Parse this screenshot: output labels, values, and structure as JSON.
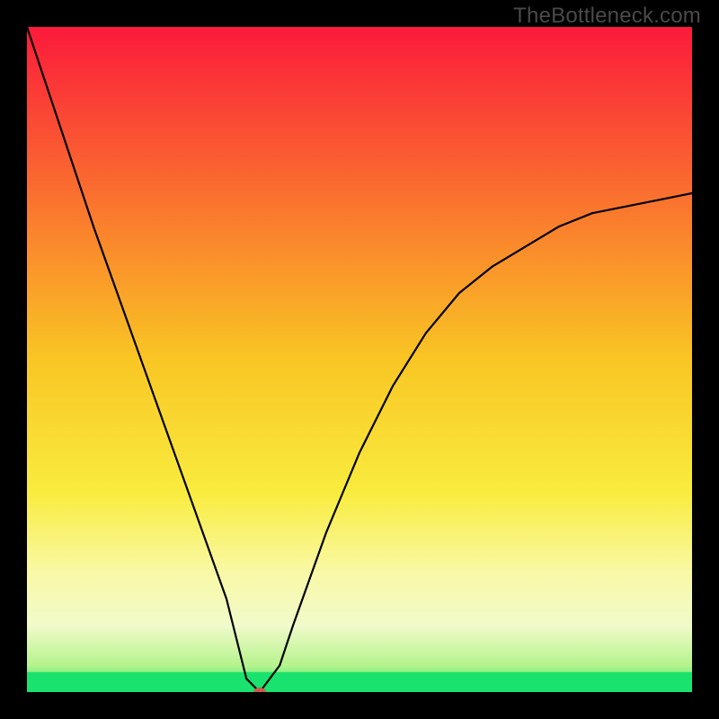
{
  "watermark": "TheBottleneck.com",
  "chart_data": {
    "type": "line",
    "title": "",
    "xlabel": "",
    "ylabel": "",
    "xlim": [
      0,
      100
    ],
    "ylim": [
      0,
      100
    ],
    "background": "gradient-red-to-green",
    "series": [
      {
        "name": "bottleneck-curve",
        "color": "#000000",
        "x": [
          0,
          5,
          10,
          15,
          20,
          25,
          30,
          33,
          35,
          38,
          40,
          45,
          50,
          55,
          60,
          65,
          70,
          75,
          80,
          85,
          90,
          95,
          100
        ],
        "values": [
          100,
          85,
          70,
          56,
          42,
          28,
          14,
          2,
          0,
          4,
          10,
          24,
          36,
          46,
          54,
          60,
          64,
          67,
          70,
          72,
          73,
          74,
          75
        ]
      }
    ],
    "marker": {
      "x": 35,
      "y": 0,
      "color": "#c95a52"
    },
    "green_band": {
      "y0": 0,
      "y1": 3
    },
    "gradient_stops": [
      {
        "offset": 0.0,
        "color": "#fb1a3b"
      },
      {
        "offset": 0.25,
        "color": "#fa6f2f"
      },
      {
        "offset": 0.5,
        "color": "#f9c624"
      },
      {
        "offset": 0.7,
        "color": "#f9ec3e"
      },
      {
        "offset": 0.82,
        "color": "#f9f9a6"
      },
      {
        "offset": 0.9,
        "color": "#f1faca"
      },
      {
        "offset": 0.96,
        "color": "#b6f38d"
      },
      {
        "offset": 1.0,
        "color": "#19e36e"
      }
    ]
  }
}
